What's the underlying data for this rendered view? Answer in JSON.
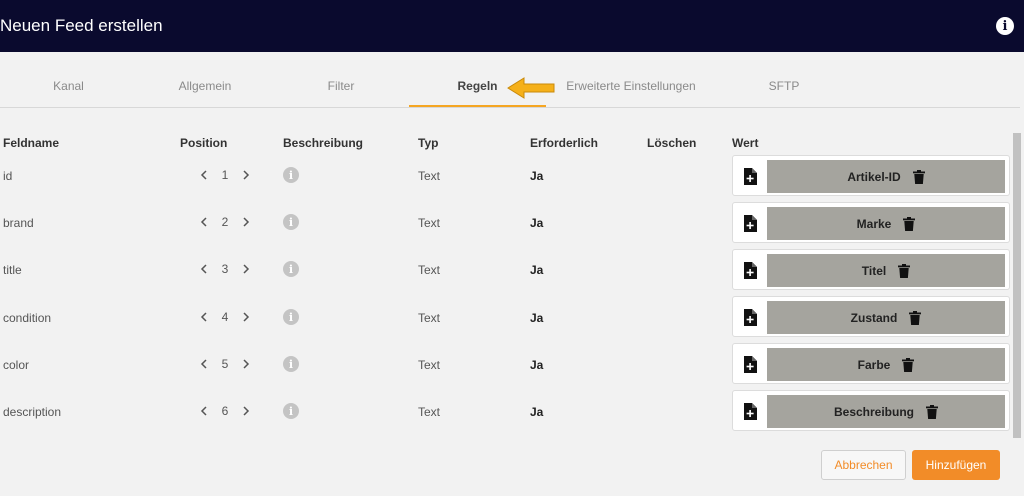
{
  "header": {
    "title": "Neuen Feed erstellen",
    "info_glyph": "i"
  },
  "tabs": [
    {
      "label": "Kanal"
    },
    {
      "label": "Allgemein"
    },
    {
      "label": "Filter"
    },
    {
      "label": "Regeln",
      "active": true
    },
    {
      "label": "Erweiterte Einstellungen"
    },
    {
      "label": "SFTP"
    }
  ],
  "accent_color": "#f5a623",
  "columns": {
    "feldname": "Feldname",
    "position": "Position",
    "beschreibung": "Beschreibung",
    "typ": "Typ",
    "erforderlich": "Erforderlich",
    "loeschen": "Löschen",
    "wert": "Wert"
  },
  "rows": [
    {
      "feldname": "id",
      "position": "1",
      "typ": "Text",
      "erforderlich": "Ja",
      "wert": "Artikel-ID"
    },
    {
      "feldname": "brand",
      "position": "2",
      "typ": "Text",
      "erforderlich": "Ja",
      "wert": "Marke"
    },
    {
      "feldname": "title",
      "position": "3",
      "typ": "Text",
      "erforderlich": "Ja",
      "wert": "Titel"
    },
    {
      "feldname": "condition",
      "position": "4",
      "typ": "Text",
      "erforderlich": "Ja",
      "wert": "Zustand"
    },
    {
      "feldname": "color",
      "position": "5",
      "typ": "Text",
      "erforderlich": "Ja",
      "wert": "Farbe"
    },
    {
      "feldname": "description",
      "position": "6",
      "typ": "Text",
      "erforderlich": "Ja",
      "wert": "Beschreibung"
    }
  ],
  "footer": {
    "cancel_label": "Abbrechen",
    "add_label": "Hinzufügen"
  }
}
